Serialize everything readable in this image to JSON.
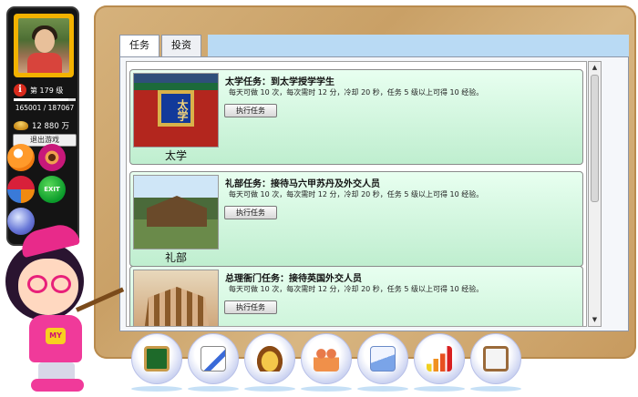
{
  "status": {
    "rank_value": "179",
    "xp_text": "165001 / 187067",
    "xp_progress": 0.88,
    "money_text": "12 880 万",
    "logout_label": "退出游戏"
  },
  "menu_icons": [
    "map-icon",
    "music-icon",
    "refresh-icon",
    "exit-icon",
    "help-icon"
  ],
  "menu_exit_label": "EXIT",
  "tabs": [
    {
      "label": "任务",
      "active": true
    },
    {
      "label": "投资",
      "active": false
    }
  ],
  "tasks": [
    {
      "place": "太学",
      "title": "太学任务：到太学授学学生",
      "desc": "每天可做 10 次，每次需时 12 分，冷却 20 秒，任务 5 级以上可得 10 经验。",
      "button": "执行任务"
    },
    {
      "place": "礼部",
      "title": "礼部任务：接待马六甲苏丹及外交人员",
      "desc": "每天可做 10 次，每次需时 12 分，冷却 20 秒，任务 5 级以上可得 10 经验。",
      "button": "执行任务"
    },
    {
      "place": "",
      "title": "总理衙门任务：接待英国外交人员",
      "desc": "每天可做 10 次，每次需时 12 分，冷却 20 秒，任务 5 级以上可得 10 经验。",
      "button": "执行任务"
    }
  ],
  "dock": [
    "chalkboard-icon",
    "edit-icon",
    "gold-ingot-icon",
    "people-icon",
    "mail-icon",
    "chart-icon",
    "clipboard-icon"
  ]
}
